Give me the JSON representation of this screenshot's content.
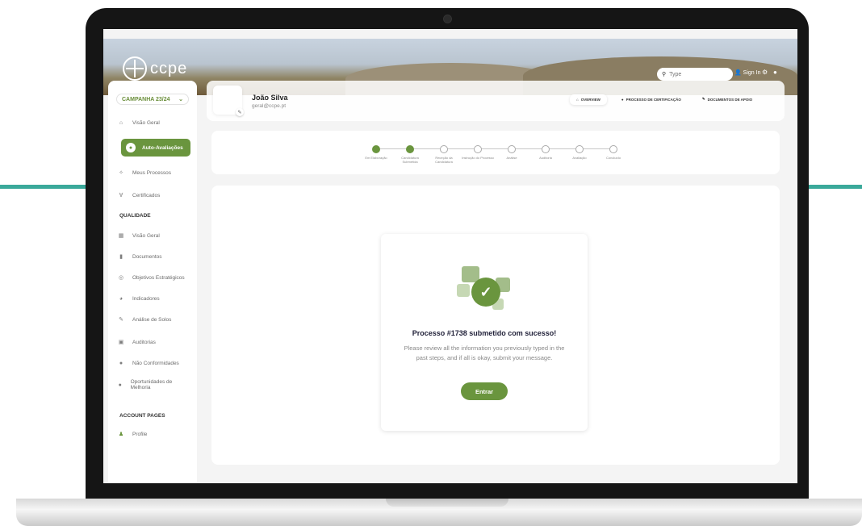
{
  "topbar": {
    "logo_text": "ccpe",
    "search_placeholder": "Type",
    "sign_in": "Sign In"
  },
  "sidebar": {
    "campaign": "CAMPANHA 23/24",
    "items": [
      {
        "label": "Visão Geral",
        "icon": "home-icon"
      },
      {
        "label": "Auto-Avaliações",
        "icon": "clipboard-icon",
        "active": true
      },
      {
        "label": "Meus Processos",
        "icon": "process-icon"
      },
      {
        "label": "Certificados",
        "icon": "medal-icon"
      }
    ],
    "quality_title": "QUALIDADE",
    "quality_items": [
      {
        "label": "Visão Geral",
        "icon": "grid-icon"
      },
      {
        "label": "Documentos",
        "icon": "document-icon"
      },
      {
        "label": "Objetivos Estratégicos",
        "icon": "target-icon"
      },
      {
        "label": "Indicadores",
        "icon": "gauge-icon"
      },
      {
        "label": "Análise de Solos",
        "icon": "pencil-icon"
      },
      {
        "label": "Auditorias",
        "icon": "audit-icon"
      },
      {
        "label": "Não Conformidades",
        "icon": "alert-icon"
      },
      {
        "label": "Oportunidades de Melhoria",
        "icon": "improve-icon"
      }
    ],
    "account_title": "ACCOUNT PAGES",
    "account_items": [
      {
        "label": "Profile",
        "icon": "person-icon"
      }
    ]
  },
  "profile": {
    "name": "João Silva",
    "email": "geral@ccpe.pt",
    "tabs": [
      {
        "label": "OVERVIEW",
        "icon": "home-icon",
        "selected": true
      },
      {
        "label": "PROCESSO DE CERTIFICAÇÃO",
        "icon": "cert-icon"
      },
      {
        "label": "DOCUMENTOS DE APOIO",
        "icon": "doc-icon"
      }
    ]
  },
  "stepper": {
    "steps": [
      {
        "label": "Em Elaboração",
        "done": true
      },
      {
        "label": "Candidatura Submetida",
        "done": true
      },
      {
        "label": "Receção da Candidatura",
        "done": false
      },
      {
        "label": "Instrução do Processo",
        "done": false
      },
      {
        "label": "Análise",
        "done": false
      },
      {
        "label": "Auditoria",
        "done": false
      },
      {
        "label": "Avaliação",
        "done": false
      },
      {
        "label": "Concluído",
        "done": false
      }
    ]
  },
  "success": {
    "title": "Processo #1738 submetido com sucesso!",
    "description": "Please review all the information you previously typed in the past steps, and if all is okay, submit your message.",
    "button": "Entrar"
  },
  "colors": {
    "primary": "#6a953e",
    "teal": "#3aa99a",
    "text_dark": "#22223a"
  }
}
